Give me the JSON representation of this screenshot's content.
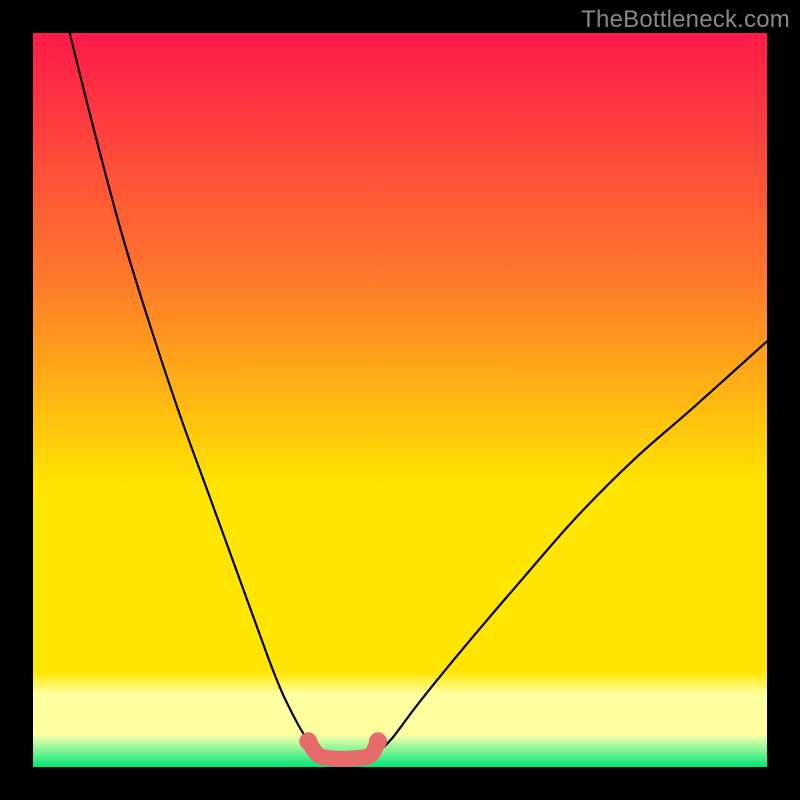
{
  "watermark": "TheBottleneck.com",
  "colors": {
    "frame": "#000000",
    "curve": "#000000",
    "highlight": "#e86b6b",
    "gradient_top": "#ff1a4a",
    "gradient_mid1": "#ff7a2a",
    "gradient_mid2": "#ffe600",
    "gradient_band": "#ffffa0",
    "gradient_bottom": "#00e676"
  },
  "chart_data": {
    "type": "line",
    "title": "",
    "xlabel": "",
    "ylabel": "",
    "xlim": [
      0,
      100
    ],
    "ylim": [
      0,
      100
    ],
    "series": [
      {
        "name": "left-curve",
        "x": [
          5,
          8,
          12,
          16,
          20,
          24,
          28,
          32,
          34,
          36,
          37.5,
          38.5,
          39
        ],
        "y": [
          100,
          88,
          73,
          60,
          48,
          37,
          26,
          15,
          10,
          6,
          3.5,
          2,
          1.3
        ]
      },
      {
        "name": "right-curve",
        "x": [
          46,
          47,
          49,
          52,
          56,
          61,
          67,
          74,
          82,
          90,
          100
        ],
        "y": [
          1.3,
          2,
          4,
          8,
          13,
          19,
          26,
          34,
          42,
          49,
          58
        ]
      },
      {
        "name": "bottom-highlight",
        "x": [
          37.5,
          38.5,
          39.3,
          40.5,
          42,
          44,
          45.5,
          46.3,
          47
        ],
        "y": [
          3.5,
          2,
          1.4,
          1.2,
          1.1,
          1.2,
          1.4,
          2,
          3.5
        ]
      }
    ],
    "annotations": []
  }
}
